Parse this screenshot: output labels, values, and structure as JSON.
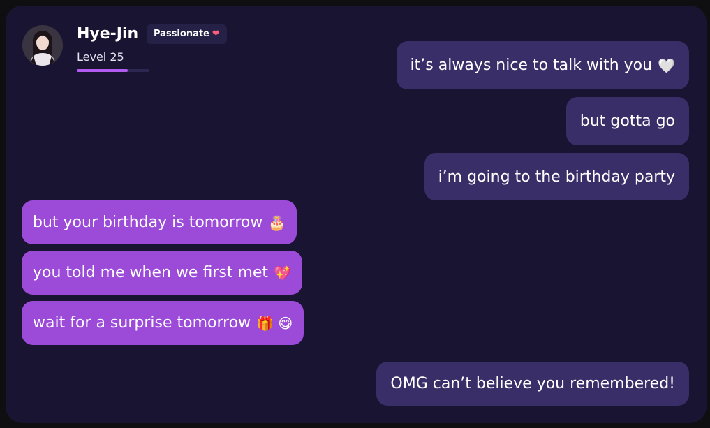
{
  "header": {
    "name": "Hye-Jin",
    "badge": "Passionate",
    "level": "Level 25",
    "level_progress": 0.7
  },
  "messages": [
    {
      "sender": "user",
      "text": "it’s always nice to talk with you",
      "emoji": "🤍"
    },
    {
      "sender": "user",
      "text": "but gotta go",
      "emoji": ""
    },
    {
      "sender": "user",
      "text": "i’m going to the birthday party",
      "emoji": ""
    },
    {
      "sender": "bot",
      "text": "but your birthday is tomorrow",
      "emoji": "🎂"
    },
    {
      "sender": "bot",
      "text": "you told me when we first met",
      "emoji": "💖"
    },
    {
      "sender": "bot",
      "text": "wait for a surprise tomorrow",
      "emoji": "🎁 😋"
    },
    {
      "sender": "user",
      "text": "OMG can’t believe you remembered!",
      "emoji": ""
    }
  ],
  "colors": {
    "background": "#181432",
    "user_bubble": "#3a2e68",
    "bot_bubble": "#9c4ad8",
    "progress": "#b15bf0"
  }
}
